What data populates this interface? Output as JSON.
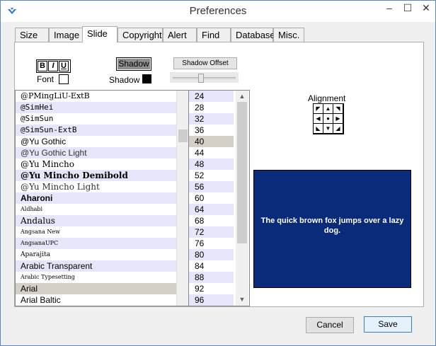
{
  "window": {
    "title": "Preferences",
    "minimize": "–",
    "maximize": "☐",
    "close": "✕"
  },
  "tabs": [
    "Size",
    "Image",
    "Slide",
    "Copyright",
    "Alert",
    "Find",
    "Database",
    "Misc."
  ],
  "active_tab": "Slide",
  "style": {
    "bold": "B",
    "italic": "I",
    "underline": "U",
    "font_label": "Font",
    "shadow_label": "Shadow",
    "shadow_button": "Shadow",
    "shadow_offset_button": "Shadow Offset",
    "shadow_color": "#000000"
  },
  "fonts": [
    "@PMingLiU-ExtB",
    "@SimHei",
    "@SimSun",
    "@SimSun-ExtB",
    "@Yu Gothic",
    "@Yu Gothic Light",
    "@Yu Mincho",
    "@Yu Mincho Demibold",
    "@Yu Mincho Light",
    "Aharoni",
    "Aldhabi",
    "Andalus",
    "Angsana New",
    "AngsanaUPC",
    "Aparajita",
    "Arabic Transparent",
    "Arabic Typesetting",
    "Arial",
    "Arial Baltic"
  ],
  "selected_font": "Arial",
  "sizes": [
    "24",
    "28",
    "32",
    "36",
    "40",
    "44",
    "48",
    "52",
    "56",
    "60",
    "64",
    "68",
    "72",
    "76",
    "80",
    "84",
    "88",
    "92",
    "96"
  ],
  "selected_size": "40",
  "alignment": {
    "label": "Alignment",
    "cells": [
      "◤",
      "▲",
      "◥",
      "◀",
      "●",
      "▶",
      "◣",
      "▼",
      "◢"
    ]
  },
  "preview": {
    "text": "The quick brown fox jumps over a lazy dog.",
    "background": "#0a2a7a",
    "text_color": "#ffffff"
  },
  "buttons": {
    "cancel": "Cancel",
    "save": "Save"
  },
  "accent": "#3c7fb1"
}
